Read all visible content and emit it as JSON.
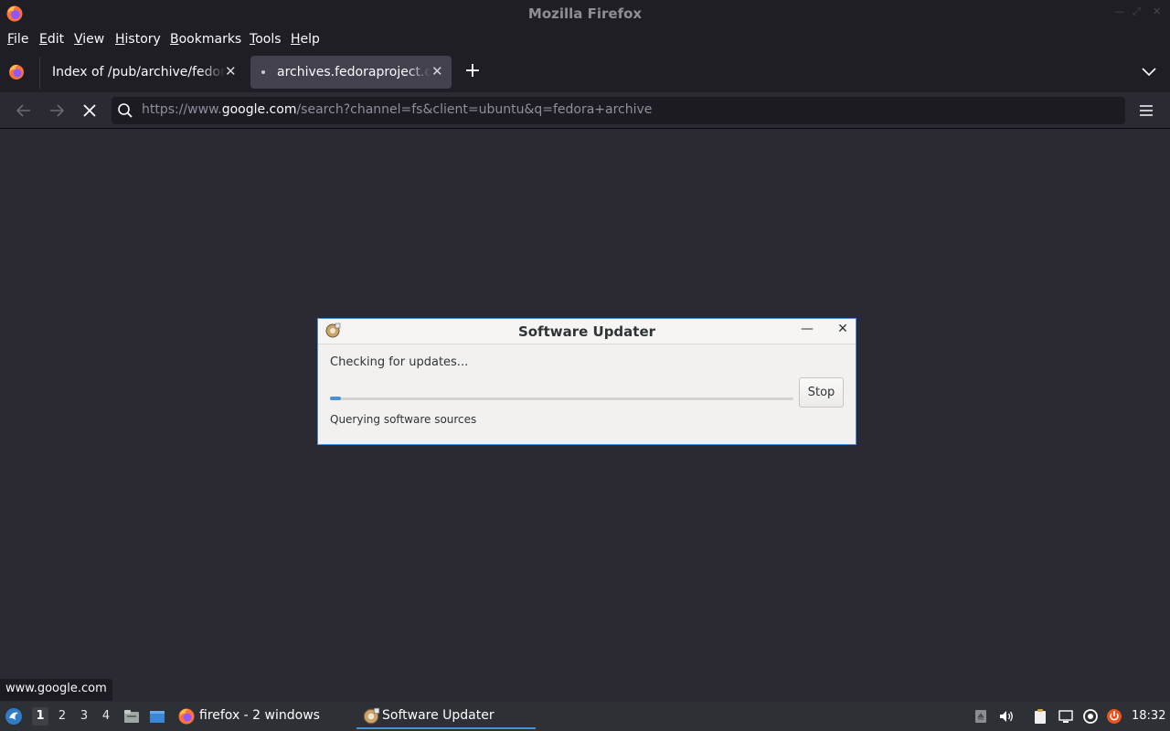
{
  "window": {
    "title": "Mozilla Firefox"
  },
  "menubar": {
    "items": [
      {
        "label": "File",
        "mnemonic": "F",
        "rest": "ile"
      },
      {
        "label": "Edit",
        "mnemonic": "E",
        "rest": "dit"
      },
      {
        "label": "View",
        "mnemonic": "V",
        "rest": "iew"
      },
      {
        "label": "History",
        "mnemonic": "H",
        "rest": "istory"
      },
      {
        "label": "Bookmarks",
        "mnemonic": "B",
        "rest": "ookmarks"
      },
      {
        "label": "Tools",
        "mnemonic": "T",
        "rest": "ools"
      },
      {
        "label": "Help",
        "mnemonic": "H",
        "rest": "elp"
      }
    ]
  },
  "tabs": [
    {
      "label": "Index of /pub/archive/fedora",
      "active": false
    },
    {
      "label": "archives.fedoraproject.org",
      "active": true,
      "loading": true
    }
  ],
  "navbar": {
    "url_prefix": "https://www.",
    "url_host": "google.com",
    "url_path": "/search?channel=fs&client=ubuntu&q=fedora+archive"
  },
  "dialog": {
    "title": "Software Updater",
    "status": "Checking for updates...",
    "progress": 0.02,
    "stop_label": "Stop",
    "detail": "Querying software sources",
    "accent": "#4a90d9"
  },
  "status_link": "www.google.com",
  "taskbar": {
    "workspaces": [
      "1",
      "2",
      "3",
      "4"
    ],
    "active_workspace": "1",
    "tasks": [
      {
        "label": "firefox - 2 windows",
        "icon": "firefox-icon"
      },
      {
        "label": "Software Updater",
        "icon": "software-updater-icon",
        "active": true
      }
    ],
    "clock": "18:32"
  }
}
